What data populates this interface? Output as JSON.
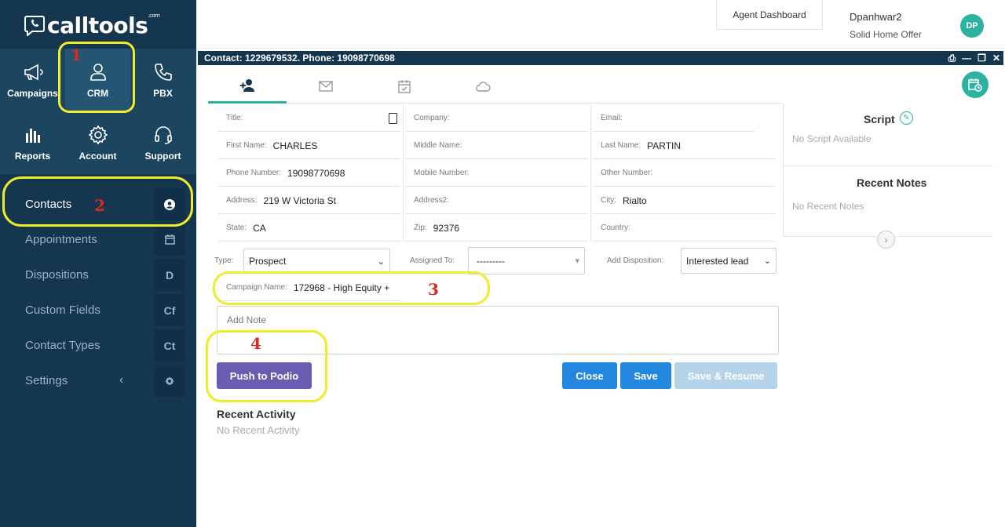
{
  "brand": {
    "name": "calltools",
    "suffix": ".com"
  },
  "topnav": [
    {
      "label": "Campaigns",
      "icon": "megaphone-icon"
    },
    {
      "label": "CRM",
      "icon": "user-icon"
    },
    {
      "label": "PBX",
      "icon": "phone-icon"
    },
    {
      "label": "Reports",
      "icon": "bar-chart-icon"
    },
    {
      "label": "Account",
      "icon": "gear-icon"
    },
    {
      "label": "Support",
      "icon": "headset-icon"
    }
  ],
  "submenu": [
    {
      "label": "Contacts",
      "badge": ""
    },
    {
      "label": "Appointments",
      "badge": ""
    },
    {
      "label": "Dispositions",
      "badge": "D"
    },
    {
      "label": "Custom Fields",
      "badge": "Cf"
    },
    {
      "label": "Contact Types",
      "badge": "Ct"
    },
    {
      "label": "Settings",
      "badge": "",
      "caret": "‹"
    }
  ],
  "header": {
    "agent_dashboard": "Agent Dashboard",
    "user_name": "Dpanhwar2",
    "company": "Solid Home Offer",
    "initials": "DP"
  },
  "contact_bar": {
    "title": "Contact: 1229679532. Phone: 19098770698"
  },
  "fields": {
    "title": {
      "label": "Title:",
      "value": ""
    },
    "company": {
      "label": "Company:",
      "value": ""
    },
    "email": {
      "label": "Email:",
      "value": ""
    },
    "first_name": {
      "label": "First Name:",
      "value": "CHARLES"
    },
    "middle_name": {
      "label": "Middle Name:",
      "value": ""
    },
    "last_name": {
      "label": "Last Name:",
      "value": "PARTIN"
    },
    "phone": {
      "label": "Phone Number:",
      "value": "19098770698"
    },
    "mobile": {
      "label": "Mobile Number:",
      "value": ""
    },
    "other": {
      "label": "Other Number:",
      "value": ""
    },
    "address": {
      "label": "Address:",
      "value": "219 W Victoria St"
    },
    "address2": {
      "label": "Address2:",
      "value": ""
    },
    "city": {
      "label": "City:",
      "value": "Rialto"
    },
    "state": {
      "label": "State:",
      "value": "CA"
    },
    "zip": {
      "label": "Zip:",
      "value": "92376"
    },
    "country": {
      "label": "Country:",
      "value": ""
    },
    "campaign": {
      "label": "Campaign Name:",
      "value": "172968 - High Equity +"
    }
  },
  "selects": {
    "type": {
      "label": "Type:",
      "value": "Prospect"
    },
    "assigned": {
      "label": "Assigned To:",
      "value": "---------"
    },
    "disposition": {
      "label": "Add Disposition:",
      "value": "Interested lead"
    }
  },
  "note": {
    "placeholder": "Add Note"
  },
  "buttons": {
    "podio": "Push to Podio",
    "close": "Close",
    "save": "Save",
    "save_resume": "Save & Resume"
  },
  "recent_activity": {
    "title": "Recent Activity",
    "empty": "No Recent Activity"
  },
  "right_panel": {
    "script_title": "Script",
    "script_empty": "No Script Available",
    "notes_title": "Recent Notes",
    "notes_empty": "No Recent Notes"
  },
  "annotations": [
    "1",
    "2",
    "3",
    "4"
  ],
  "colors": {
    "sidebar": "#14374f",
    "accent": "#2bb3a0",
    "primary": "#2386df",
    "podio": "#6a5cb0",
    "highlight": "#f0ec2a",
    "marker": "#e0281e"
  }
}
